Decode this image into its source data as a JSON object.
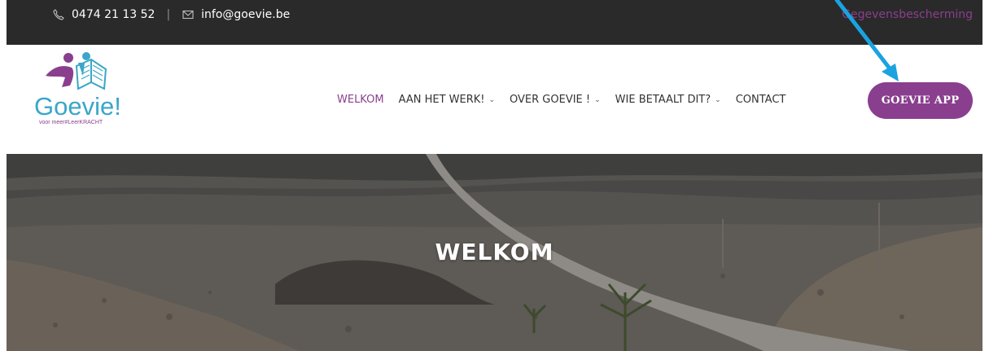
{
  "topbar": {
    "phone": "0474 21 13 52",
    "separator": "|",
    "email": "info@goevie.be",
    "privacy_link": "Gegevensbescherming"
  },
  "logo": {
    "name": "Goevie!",
    "tagline": "voor meer#LeerKRACHT"
  },
  "nav": {
    "items": [
      {
        "label": "WELKOM",
        "active": true,
        "dropdown": false
      },
      {
        "label": "AAN HET WERK!",
        "active": false,
        "dropdown": true
      },
      {
        "label": "OVER GOEVIE !",
        "active": false,
        "dropdown": true
      },
      {
        "label": "WIE BETAALT DIT?",
        "active": false,
        "dropdown": true
      },
      {
        "label": "CONTACT",
        "active": false,
        "dropdown": false
      }
    ],
    "cta_label": "GOEVIE APP"
  },
  "hero": {
    "title": "WELKOM"
  },
  "colors": {
    "brand_purple": "#8a3f8e",
    "brand_blue": "#3aa6c9",
    "topbar_bg": "#2a2a2a",
    "annotation_arrow": "#1aa3e0"
  },
  "icons": {
    "phone": "phone-icon",
    "email": "envelope-icon",
    "chevron": "chevron-down-icon",
    "annotation": "arrow-annotation"
  }
}
